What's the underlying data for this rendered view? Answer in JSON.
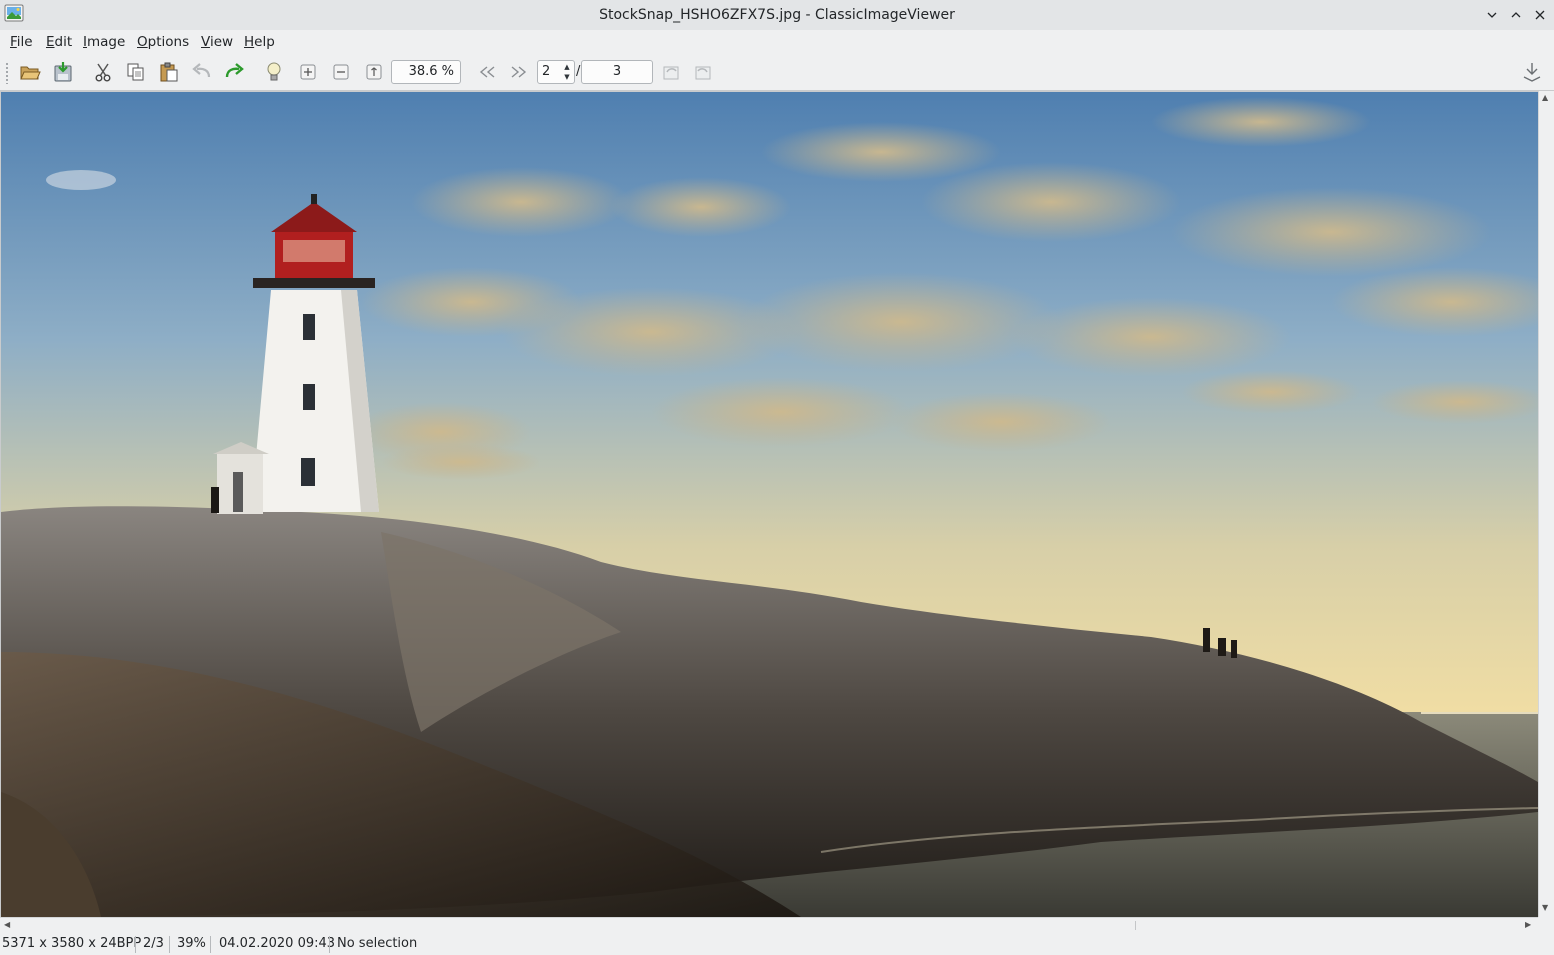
{
  "window": {
    "title": "StockSnap_HSHO6ZFX7S.jpg - ClassicImageViewer",
    "app_icon": "image-viewer-icon",
    "controls": [
      "minimize-icon",
      "maximize-icon",
      "close-icon"
    ]
  },
  "menubar": {
    "items": [
      {
        "label": "File",
        "mnemonic": "F",
        "rest": "ile"
      },
      {
        "label": "Edit",
        "mnemonic": "E",
        "rest": "dit"
      },
      {
        "label": "Image",
        "mnemonic": "I",
        "rest": "mage"
      },
      {
        "label": "Options",
        "mnemonic": "O",
        "rest": "ptions"
      },
      {
        "label": "View",
        "mnemonic": "V",
        "rest": "iew"
      },
      {
        "label": "Help",
        "mnemonic": "H",
        "rest": "elp"
      }
    ]
  },
  "toolbar": {
    "buttons": [
      "open-icon",
      "save-icon",
      "cut-icon",
      "copy-icon",
      "paste-icon",
      "undo-icon",
      "redo-icon",
      "info-bulb-icon",
      "zoom-in-icon",
      "zoom-out-icon",
      "fit-icon",
      "first-image-icon",
      "next-image-icon",
      "rotate-left-icon",
      "rotate-right-icon",
      "download-icon"
    ],
    "zoom_value": "38.6 %",
    "page_current": "2",
    "page_separator": "/",
    "page_total": "3"
  },
  "image": {
    "subject": "lighthouse-on-rocks-photo"
  },
  "statusbar": {
    "dimensions": "5371 x 3580 x 24BPP",
    "position": "2/3",
    "zoom": "39%",
    "datetime": "04.02.2020 09:43",
    "selection": "No selection"
  },
  "colors": {
    "accent_redo": "#2c9a2c",
    "chrome_bg": "#eff0f1"
  }
}
